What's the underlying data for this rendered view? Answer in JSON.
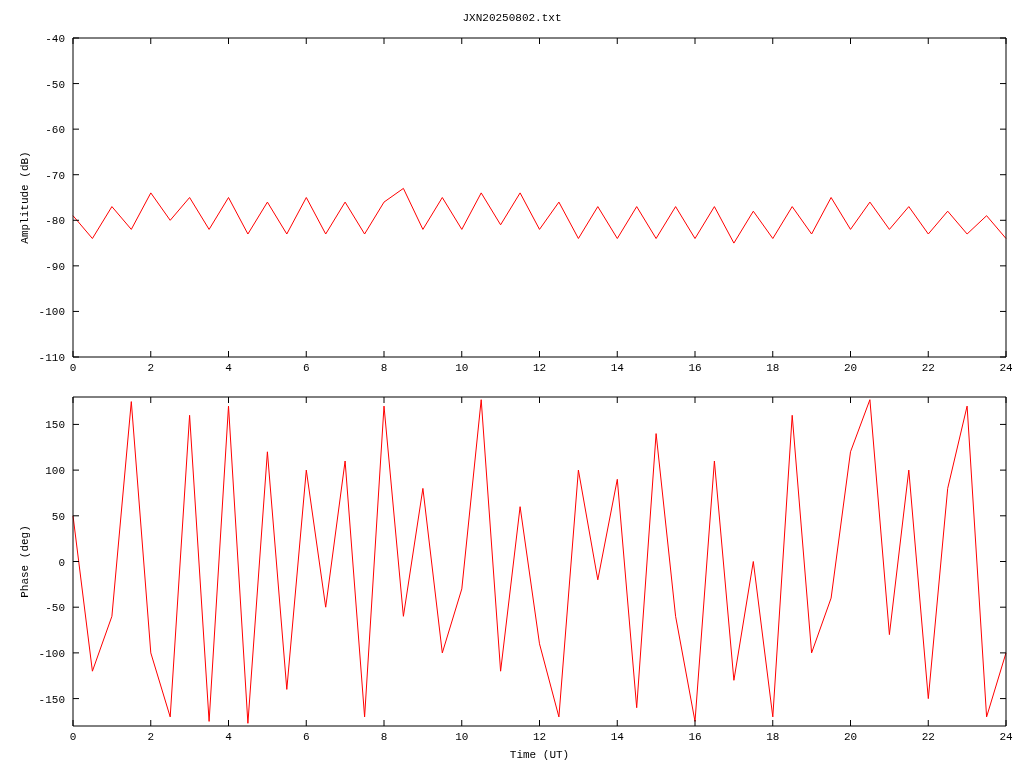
{
  "figure": {
    "title": "JXN20250802.txt"
  },
  "charts": [
    {
      "chart_data": {
        "type": "line",
        "ylabel": "Amplitude (dB)",
        "xlim": [
          0,
          24
        ],
        "ylim": [
          -110,
          -40
        ],
        "xticks": [
          0,
          2,
          4,
          6,
          8,
          10,
          12,
          14,
          16,
          18,
          20,
          22,
          24
        ],
        "yticks": [
          -110,
          -100,
          -90,
          -80,
          -70,
          -60,
          -50,
          -40
        ],
        "x": [
          0,
          0.5,
          1,
          1.5,
          2,
          2.5,
          3,
          3.5,
          4,
          4.5,
          5,
          5.5,
          6,
          6.5,
          7,
          7.5,
          8,
          8.5,
          9,
          9.5,
          10,
          10.5,
          11,
          11.5,
          12,
          12.5,
          13,
          13.5,
          14,
          14.5,
          15,
          15.5,
          16,
          16.5,
          17,
          17.5,
          18,
          18.5,
          19,
          19.5,
          20,
          20.5,
          21,
          21.5,
          22,
          22.5,
          23,
          23.5,
          24
        ],
        "series": [
          {
            "color": "#ff0000",
            "values": [
              -79,
              -84,
              -77,
              -82,
              -74,
              -80,
              -75,
              -82,
              -75,
              -83,
              -76,
              -83,
              -75,
              -83,
              -76,
              -83,
              -76,
              -73,
              -82,
              -75,
              -82,
              -74,
              -81,
              -74,
              -82,
              -76,
              -84,
              -77,
              -84,
              -77,
              -84,
              -77,
              -84,
              -77,
              -85,
              -78,
              -84,
              -77,
              -83,
              -75,
              -82,
              -76,
              -82,
              -77,
              -83,
              -78,
              -83,
              -79,
              -84
            ]
          }
        ]
      }
    },
    {
      "chart_data": {
        "type": "line",
        "xlabel": "Time (UT)",
        "ylabel": "Phase (deg)",
        "xlim": [
          0,
          24
        ],
        "ylim": [
          -180,
          180
        ],
        "xticks": [
          0,
          2,
          4,
          6,
          8,
          10,
          12,
          14,
          16,
          18,
          20,
          22,
          24
        ],
        "yticks": [
          -150,
          -100,
          -50,
          0,
          50,
          100,
          150
        ],
        "x": [
          0,
          0.5,
          1,
          1.5,
          2,
          2.5,
          3,
          3.5,
          4,
          4.5,
          5,
          5.5,
          6,
          6.5,
          7,
          7.5,
          8,
          8.5,
          9,
          9.5,
          10,
          10.5,
          11,
          11.5,
          12,
          12.5,
          13,
          13.5,
          14,
          14.5,
          15,
          15.5,
          16,
          16.5,
          17,
          17.5,
          18,
          18.5,
          19,
          19.5,
          20,
          20.5,
          21,
          21.5,
          22,
          22.5,
          23,
          23.5,
          24
        ],
        "series": [
          {
            "color": "#ff0000",
            "values": [
              50,
              -120,
              -60,
              175,
              -100,
              -170,
              160,
              -175,
              170,
              -177,
              120,
              -140,
              100,
              -50,
              110,
              -170,
              170,
              -60,
              80,
              -100,
              -30,
              177,
              -120,
              60,
              -90,
              -170,
              100,
              -20,
              90,
              -160,
              140,
              -60,
              -175,
              110,
              -130,
              0,
              -170,
              160,
              -100,
              -40,
              120,
              177,
              -80,
              100,
              -150,
              80,
              170,
              -170,
              -100
            ]
          }
        ]
      }
    }
  ]
}
